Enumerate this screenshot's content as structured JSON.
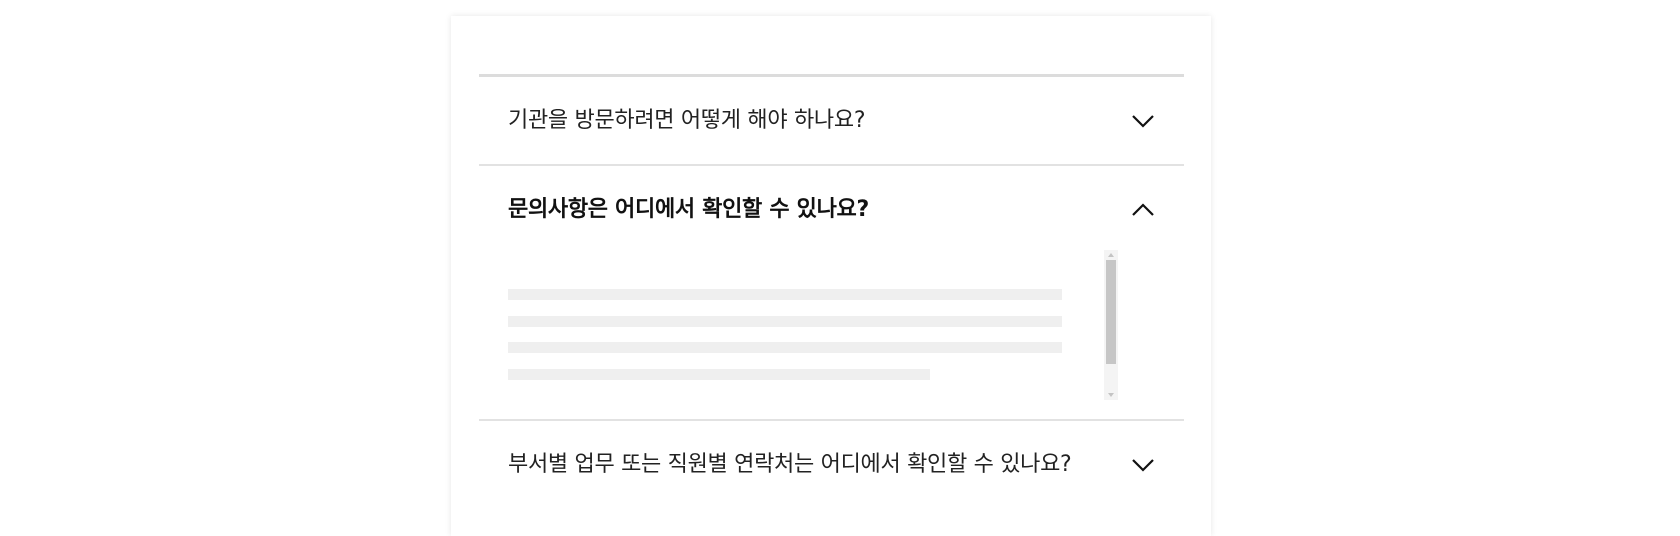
{
  "faq": {
    "items": [
      {
        "question": "기관을 방문하려면 어떻게 해야 하나요?",
        "expanded": false,
        "toggle_icon": "chevron-down-icon"
      },
      {
        "question": "문의사항은 어디에서 확인할 수 있나요?",
        "expanded": true,
        "toggle_icon": "chevron-up-icon"
      },
      {
        "question": "부서별 업무 또는 직원별 연락처는 어디에서 확인할 수 있나요?",
        "expanded": false,
        "toggle_icon": "chevron-down-icon"
      }
    ]
  },
  "colors": {
    "divider": "#dcdcdc",
    "text": "#222222",
    "placeholder": "#efefef",
    "scroll_thumb": "#c6c6c6"
  }
}
